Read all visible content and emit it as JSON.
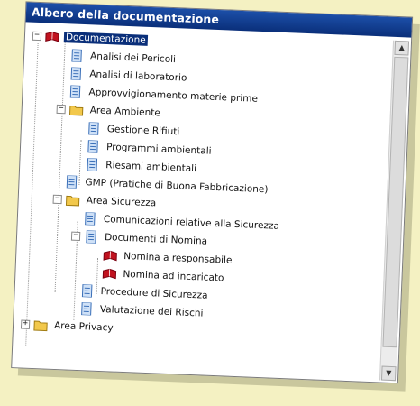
{
  "window": {
    "title": "Albero della documentazione"
  },
  "tree": {
    "root": "Documentazione",
    "items": [
      "Analisi dei Pericoli",
      "Analisi di laboratorio",
      "Approvvigionamento materie prime",
      "Area Ambiente",
      "Gestione Rifiuti",
      "Programmi ambientali",
      "Riesami ambientali",
      "GMP (Pratiche di Buona Fabbricazione)",
      "Area Sicurezza",
      "Comunicazioni relative alla Sicurezza",
      "Documenti di Nomina",
      "Nomina a responsabile",
      "Nomina ad incaricato",
      "Procedure di Sicurezza",
      "Valutazione dei Rischi",
      "Area Privacy"
    ]
  },
  "icons": {
    "book": "book-icon",
    "document": "document-icon",
    "folder": "folder-icon"
  },
  "colors": {
    "background": "#f4f1c2",
    "titlebar": "#0a2f7a",
    "selection": "#0a2f7a",
    "folder": "#f2c84b",
    "document": "#7aa6e0",
    "book": "#c1121f"
  }
}
